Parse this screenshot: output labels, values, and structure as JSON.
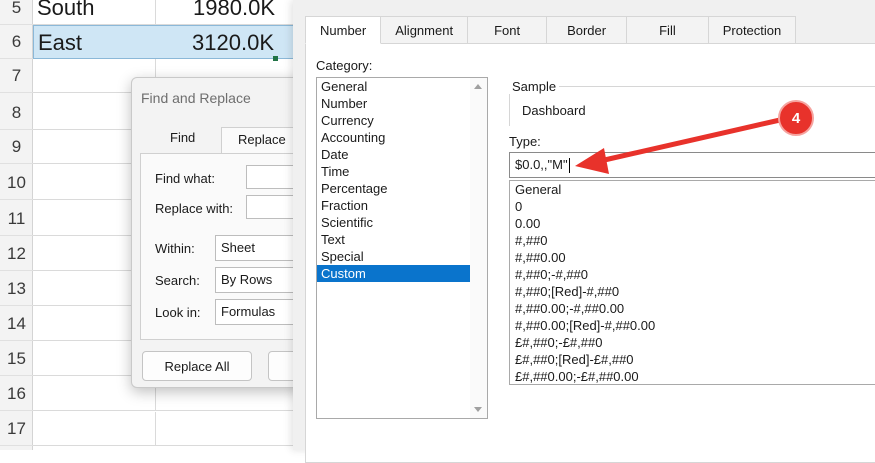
{
  "spreadsheet": {
    "row_numbers": [
      "5",
      "6",
      "7",
      "8",
      "9",
      "10",
      "11",
      "12",
      "13",
      "14",
      "15",
      "16",
      "17"
    ],
    "rows": [
      {
        "region": "South",
        "value": "1980.0K"
      },
      {
        "region": "East",
        "value": "3120.0K"
      }
    ]
  },
  "find_replace": {
    "title": "Find and Replace",
    "tabs": [
      "Find",
      "Replace"
    ],
    "active_tab": "Replace",
    "find_what_label": "Find what:",
    "find_what_value": "",
    "replace_with_label": "Replace with:",
    "replace_with_value": "",
    "within_label": "Within:",
    "within_value": "Sheet",
    "search_label": "Search:",
    "search_value": "By Rows",
    "look_in_label": "Look in:",
    "look_in_value": "Formulas",
    "replace_all_label": "Replace All"
  },
  "format_cells": {
    "tabs": [
      "Number",
      "Alignment",
      "Font",
      "Border",
      "Fill",
      "Protection"
    ],
    "active_tab": "Number",
    "category_label": "Category:",
    "categories": [
      "General",
      "Number",
      "Currency",
      "Accounting",
      "Date",
      "Time",
      "Percentage",
      "Fraction",
      "Scientific",
      "Text",
      "Special",
      "Custom"
    ],
    "selected_category": "Custom",
    "sample_label": "Sample",
    "sample_value": "Dashboard",
    "type_label": "Type:",
    "type_value": "$0.0,,\"M\"",
    "type_list": [
      "General",
      "0",
      "0.00",
      "#,##0",
      "#,##0.00",
      "#,##0;-#,##0",
      "#,##0;[Red]-#,##0",
      "#,##0.00;-#,##0.00",
      "#,##0.00;[Red]-#,##0.00",
      "£#,##0;-£#,##0",
      "£#,##0;[Red]-£#,##0",
      "£#,##0.00;-£#,##0.00"
    ]
  },
  "annotation": {
    "step_number": "4",
    "color": "#e8322b"
  },
  "colors": {
    "selection_blue": "#0a74cc",
    "row_highlight": "#cfe6f5",
    "dialog_bg": "#f0f0f0"
  }
}
